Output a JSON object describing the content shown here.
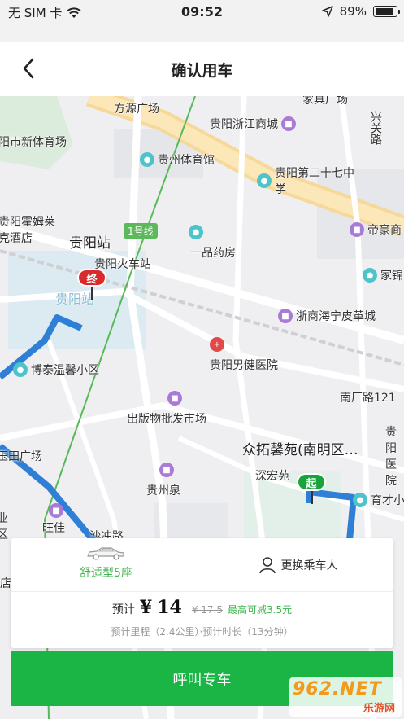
{
  "status_bar": {
    "carrier": "无 SIM 卡",
    "time": "09:52",
    "battery": "89%",
    "battery_level": 0.89,
    "icons": [
      "wifi-icon",
      "location-arrow-icon",
      "battery-icon"
    ]
  },
  "nav": {
    "title": "确认用车",
    "back_icon": "chevron-left-icon"
  },
  "map": {
    "pois": [
      {
        "name": "方源广场"
      },
      {
        "name": "家具广场"
      },
      {
        "name": "贵阳浙江商城"
      },
      {
        "name": "兴关路"
      },
      {
        "name": "阳市新体育场"
      },
      {
        "name": "贵州体育馆"
      },
      {
        "name": "贵阳第二十七中学"
      },
      {
        "name": "贵阳霍姆莱克酒店"
      },
      {
        "name": "1号线"
      },
      {
        "name": "帝豪商"
      },
      {
        "name": "贵阳站"
      },
      {
        "name": "一品药房"
      },
      {
        "name": "贵阳火车站"
      },
      {
        "name": "家锦"
      },
      {
        "name": "贵阳站"
      },
      {
        "name": "浙商海宁皮革城"
      },
      {
        "name": "贵阳男健医院"
      },
      {
        "name": "博泰温馨小区"
      },
      {
        "name": "南厂路121"
      },
      {
        "name": "出版物批发市场"
      },
      {
        "name": "众拓馨苑(南明区…"
      },
      {
        "name": "贵阳医院"
      },
      {
        "name": "玉田广场"
      },
      {
        "name": "深宏苑"
      },
      {
        "name": "育才小"
      },
      {
        "name": "贵州泉"
      },
      {
        "name": "旺佳"
      },
      {
        "name": "沙冲路"
      },
      {
        "name": "业区"
      },
      {
        "name": "店"
      }
    ],
    "end_marker": "终",
    "start_marker": "起",
    "route_color": "#2f7fd6"
  },
  "card": {
    "car_type": "舒适型5座",
    "passenger_button": "更换乘车人",
    "price_prefix": "预计",
    "price_currency": "¥",
    "price": "14",
    "price_original": "¥ 17.5",
    "price_discount": "最高可减3.5元",
    "estimate": "预计里程（2.4公里）·预计时长（13分钟）"
  },
  "call_button": "呼叫专车",
  "watermark": {
    "logo": "962.NET",
    "sub": "乐游网"
  },
  "colors": {
    "accent_green": "#1ab544",
    "route_blue": "#2f7fd6",
    "end_red": "#d92b2b",
    "start_green": "#1aa33b"
  }
}
